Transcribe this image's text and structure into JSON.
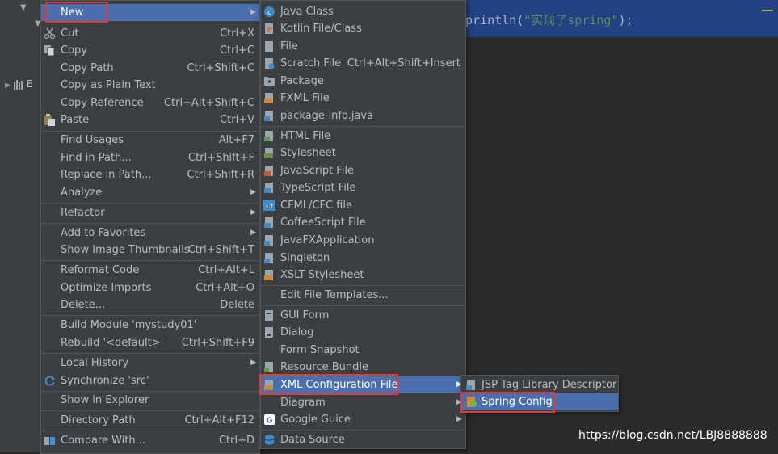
{
  "editor": {
    "code_before": "println(",
    "code_string": "\"实现了spring\"",
    "code_after": ");",
    "partial_line": "){"
  },
  "project_tree": {
    "item_label": "E"
  },
  "context_menu": {
    "items": [
      {
        "label": "New",
        "shortcut": "",
        "submenu": true,
        "icon": "none"
      },
      {
        "label": "Cut",
        "shortcut": "Ctrl+X",
        "icon": "scissors-icon"
      },
      {
        "label": "Copy",
        "shortcut": "Ctrl+C",
        "icon": "copy-icon"
      },
      {
        "label": "Copy Path",
        "shortcut": "Ctrl+Shift+C"
      },
      {
        "label": "Copy as Plain Text",
        "shortcut": ""
      },
      {
        "label": "Copy Reference",
        "shortcut": "Ctrl+Alt+Shift+C"
      },
      {
        "label": "Paste",
        "shortcut": "Ctrl+V",
        "icon": "paste-icon"
      },
      {
        "label": "Find Usages",
        "shortcut": "Alt+F7"
      },
      {
        "label": "Find in Path...",
        "shortcut": "Ctrl+Shift+F"
      },
      {
        "label": "Replace in Path...",
        "shortcut": "Ctrl+Shift+R"
      },
      {
        "label": "Analyze",
        "shortcut": "",
        "submenu": true
      },
      {
        "label": "Refactor",
        "shortcut": "",
        "submenu": true
      },
      {
        "label": "Add to Favorites",
        "shortcut": "",
        "submenu": true
      },
      {
        "label": "Show Image Thumbnails",
        "shortcut": "Ctrl+Shift+T"
      },
      {
        "label": "Reformat Code",
        "shortcut": "Ctrl+Alt+L"
      },
      {
        "label": "Optimize Imports",
        "shortcut": "Ctrl+Alt+O"
      },
      {
        "label": "Delete...",
        "shortcut": "Delete"
      },
      {
        "label": "Build Module 'mystudy01'",
        "shortcut": ""
      },
      {
        "label": "Rebuild '<default>'",
        "shortcut": "Ctrl+Shift+F9"
      },
      {
        "label": "Local History",
        "shortcut": "",
        "submenu": true
      },
      {
        "label": "Synchronize 'src'",
        "shortcut": "",
        "icon": "sync-icon"
      },
      {
        "label": "Show in Explorer",
        "shortcut": ""
      },
      {
        "label": "Directory Path",
        "shortcut": "Ctrl+Alt+F12"
      },
      {
        "label": "Compare With...",
        "shortcut": "Ctrl+D",
        "icon": "compare-icon"
      }
    ]
  },
  "new_submenu": {
    "items": [
      {
        "label": "Java Class",
        "shortcut": ""
      },
      {
        "label": "Kotlin File/Class",
        "shortcut": ""
      },
      {
        "label": "File",
        "shortcut": ""
      },
      {
        "label": "Scratch File",
        "shortcut": "Ctrl+Alt+Shift+Insert"
      },
      {
        "label": "Package",
        "shortcut": ""
      },
      {
        "label": "FXML File",
        "shortcut": ""
      },
      {
        "label": "package-info.java",
        "shortcut": ""
      },
      {
        "label": "HTML File",
        "shortcut": ""
      },
      {
        "label": "Stylesheet",
        "shortcut": ""
      },
      {
        "label": "JavaScript File",
        "shortcut": ""
      },
      {
        "label": "TypeScript File",
        "shortcut": ""
      },
      {
        "label": "CFML/CFC file",
        "shortcut": ""
      },
      {
        "label": "CoffeeScript File",
        "shortcut": ""
      },
      {
        "label": "JavaFXApplication",
        "shortcut": ""
      },
      {
        "label": "Singleton",
        "shortcut": ""
      },
      {
        "label": "XSLT Stylesheet",
        "shortcut": ""
      },
      {
        "label": "Edit File Templates...",
        "shortcut": ""
      },
      {
        "label": "GUI Form",
        "shortcut": ""
      },
      {
        "label": "Dialog",
        "shortcut": ""
      },
      {
        "label": "Form Snapshot",
        "shortcut": ""
      },
      {
        "label": "Resource Bundle",
        "shortcut": ""
      },
      {
        "label": "XML Configuration File",
        "shortcut": "",
        "submenu": true
      },
      {
        "label": "Diagram",
        "shortcut": "",
        "submenu": true
      },
      {
        "label": "Google Guice",
        "shortcut": "",
        "submenu": true
      },
      {
        "label": "Data Source",
        "shortcut": ""
      }
    ],
    "icon_badges": {
      "cf": "Cf",
      "css": "CSS",
      "js": "JS",
      "ts": "TS",
      "h": "H",
      "fx": "FX"
    }
  },
  "xml_submenu": {
    "items": [
      {
        "label": "JSP Tag Library Descriptor"
      },
      {
        "label": "Spring Config"
      }
    ]
  },
  "colors": {
    "menu_bg": "#3c3f41",
    "selection": "#4b6eaf",
    "highlight_box": "#e53935",
    "editor_selection": "#214283"
  },
  "watermark": "https://blog.csdn.net/LBJ8888888"
}
